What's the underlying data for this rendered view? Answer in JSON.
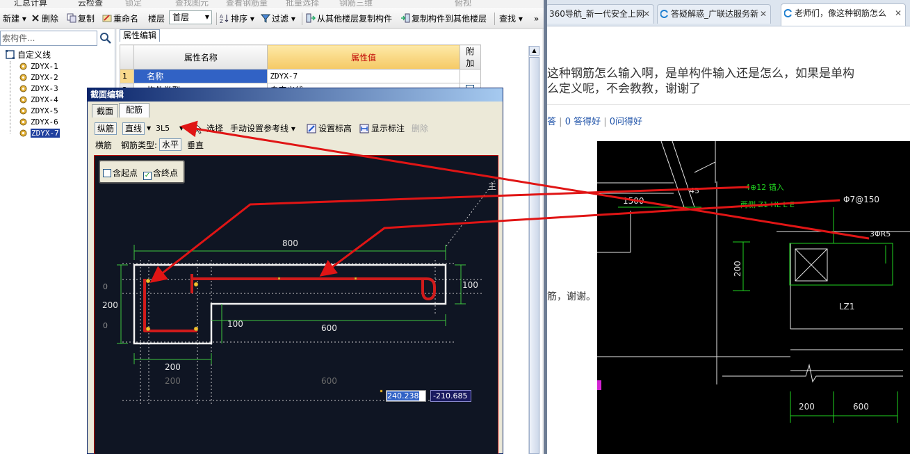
{
  "app": {
    "menu": [
      "汇总计算",
      "云检查",
      "锁定",
      "查找图元",
      "查看钢筋量",
      "批量选择",
      "钢筋三维",
      "俯视"
    ],
    "toolbar": {
      "new": "新建",
      "delete": "删除",
      "copy": "复制",
      "rename": "重命名",
      "floor_label": "楼层",
      "floor_value": "首层",
      "sort": "排序",
      "filter": "过滤",
      "copy_from_floor": "从其他楼层复制构件",
      "copy_to_floor": "复制构件到其他楼层",
      "find": "查找",
      "more": "»"
    },
    "search": {
      "placeholder": "索构件..."
    },
    "tree": {
      "root": "自定义线",
      "items": [
        "ZDYX-1",
        "ZDYX-2",
        "ZDYX-3",
        "ZDYX-4",
        "ZDYX-5",
        "ZDYX-6",
        "ZDYX-7"
      ],
      "selected": "ZDYX-7"
    },
    "properties": {
      "tab": "属性编辑",
      "headers": [
        "属性名称",
        "属性值",
        "附加"
      ],
      "rows": [
        {
          "num": "1",
          "name": "名称",
          "value": "ZDYX-7"
        },
        {
          "num": "2",
          "name": "构件类型",
          "value": "自定义线"
        }
      ]
    },
    "dialog": {
      "title": "截面编辑",
      "tabs": [
        "截面",
        "配筋"
      ],
      "active_tab": "配筋",
      "toolbar1": {
        "longitudinal": "纵筋",
        "line": "直线",
        "rebar_spec": "3L5",
        "select": "选择",
        "manual_ref": "手动设置参考线",
        "set_elevation": "设置标高",
        "show_dim": "显示标注",
        "delete": "删除"
      },
      "toolbar2": {
        "transverse": "横筋",
        "rebar_type_label": "钢筋类型:",
        "horizontal": "水平",
        "vertical": "垂直"
      },
      "options": {
        "start_point": "含起点",
        "end_point": "含终点",
        "start_checked": false,
        "end_checked": true
      },
      "dims": {
        "top": "800",
        "right": "100",
        "left": "200",
        "notch": "100",
        "bottom_right": "600",
        "bottom_left": "200",
        "grey_left": "200",
        "grey_right": "600",
        "small_left_top": "0",
        "small_left_bottom": "0",
        "corner_mark": "主"
      },
      "coord_x": "240.238",
      "coord_y": "-210.685"
    }
  },
  "browser": {
    "tabs": [
      {
        "title": "360导航_新一代安全上网",
        "active": false
      },
      {
        "title": "答疑解惑_广联达服务新",
        "active": false
      },
      {
        "title": "老师们，像这种钢筋怎么",
        "active": true
      }
    ],
    "question_line1": "这种钢筋怎么输入啊，是单构件输入还是怎么，如果是单构",
    "question_line2": "么定义呢，不会教教，谢谢了",
    "stats": [
      "答",
      "0 答得好",
      "0问得好"
    ],
    "reply": "筋，谢谢。",
    "cad": {
      "rebar_label": "4⊕12 锚入",
      "side_label": "两侧 Z1 HL L E",
      "stirrup": "Φ7@150",
      "three_r5": "3ΦR5",
      "dim_1500": "1500",
      "dim_45": "45",
      "dim_200v": "200",
      "beam": "LZ1",
      "dim_200": "200",
      "dim_600": "600"
    }
  },
  "colors": {
    "arrow": "#e01515",
    "canvas_bg": "#0f1523",
    "cad_green": "#21d421",
    "dim_green": "#3fc63f"
  }
}
